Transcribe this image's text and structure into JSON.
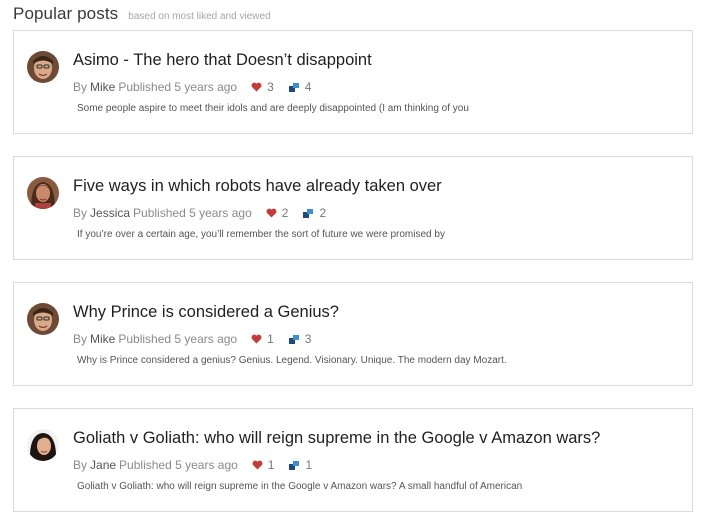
{
  "header": {
    "title": "Popular posts",
    "subtitle": "based on most liked and viewed"
  },
  "colors": {
    "heart": "#c43b3b",
    "views_dark": "#1f4b7a",
    "views_light": "#3f8fd0",
    "border": "#dadada"
  },
  "posts": [
    {
      "title": "Asimo - The hero that Doesn’t disappoint",
      "by": "By",
      "author": "Mike",
      "published": "Published 5 years ago",
      "likes": "3",
      "views": "4",
      "excerpt": "Some people aspire to meet their idols and are deeply disappointed (I am thinking of you",
      "avatar": "man-avatar"
    },
    {
      "title": "Five ways in which robots have already taken over",
      "by": "By",
      "author": "Jessica",
      "published": "Published 5 years ago",
      "likes": "2",
      "views": "2",
      "excerpt": "If you’re over a certain age, you’ll remember the sort of future we were promised by",
      "avatar": "woman-avatar"
    },
    {
      "title": "Why Prince is considered a Genius?",
      "by": "By",
      "author": "Mike",
      "published": "Published 5 years ago",
      "likes": "1",
      "views": "3",
      "excerpt": "Why is Prince considered a genius? Genius. Legend. Visionary. Unique. The modern day Mozart.",
      "avatar": "man-avatar"
    },
    {
      "title": "Goliath v Goliath: who will reign supreme in the Google v Amazon wars?",
      "by": "By",
      "author": "Jane",
      "published": "Published 5 years ago",
      "likes": "1",
      "views": "1",
      "excerpt": "Goliath v Goliath: who will reign supreme in the Google v Amazon wars? A small handful of American",
      "avatar": "woman-avatar"
    }
  ]
}
